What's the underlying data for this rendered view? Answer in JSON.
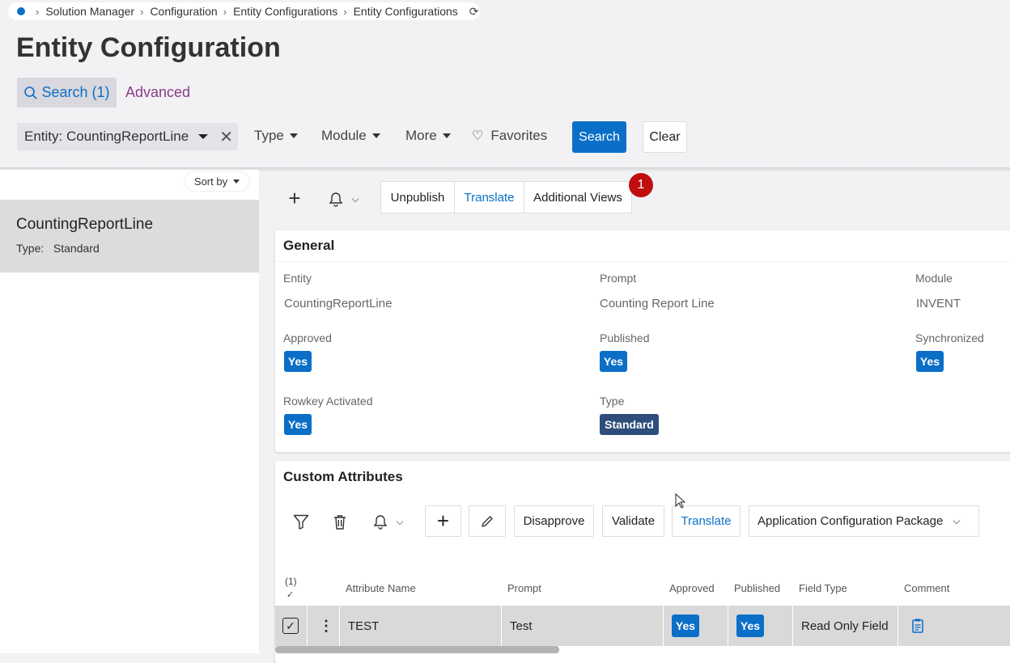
{
  "breadcrumb": {
    "items": [
      "Solution Manager",
      "Configuration",
      "Entity Configurations",
      "Entity Configurations"
    ]
  },
  "page": {
    "title": "Entity Configuration"
  },
  "search_tabs": {
    "search": "Search (1)",
    "advanced": "Advanced"
  },
  "filters": {
    "entity": "Entity: CountingReportLine",
    "type": "Type",
    "module": "Module",
    "more": "More",
    "favorites": "Favorites",
    "search_button": "Search",
    "clear_button": "Clear"
  },
  "left_panel": {
    "sort_by": "Sort by",
    "item": {
      "title": "CountingReportLine",
      "type_label": "Type:",
      "type_value": "Standard"
    }
  },
  "toolbar": {
    "unpublish": "Unpublish",
    "translate": "Translate",
    "additional_views": "Additional Views",
    "badge_count": "1"
  },
  "general": {
    "title": "General",
    "entity_label": "Entity",
    "entity_value": "CountingReportLine",
    "prompt_label": "Prompt",
    "prompt_value": "Counting Report Line",
    "module_label": "Module",
    "module_value": "INVENT",
    "approved_label": "Approved",
    "approved_value": "Yes",
    "published_label": "Published",
    "published_value": "Yes",
    "synchronized_label": "Synchronized",
    "synchronized_value": "Yes",
    "rowkey_label": "Rowkey Activated",
    "rowkey_value": "Yes",
    "type_label": "Type",
    "type_value": "Standard"
  },
  "custom_attributes": {
    "title": "Custom Attributes",
    "disapprove": "Disapprove",
    "validate": "Validate",
    "translate": "Translate",
    "package": "Application Configuration Package",
    "selected_count": "(1)",
    "columns": [
      "Attribute Name",
      "Prompt",
      "Approved",
      "Published",
      "Field Type",
      "Comment"
    ],
    "row": {
      "attribute_name": "TEST",
      "prompt": "Test",
      "approved": "Yes",
      "published": "Yes",
      "field_type": "Read Only Field"
    }
  },
  "colors": {
    "accent": "#0b6fc8",
    "advanced": "#8a3c87",
    "badge": "#c00d0d",
    "standard": "#2e4d7b"
  }
}
